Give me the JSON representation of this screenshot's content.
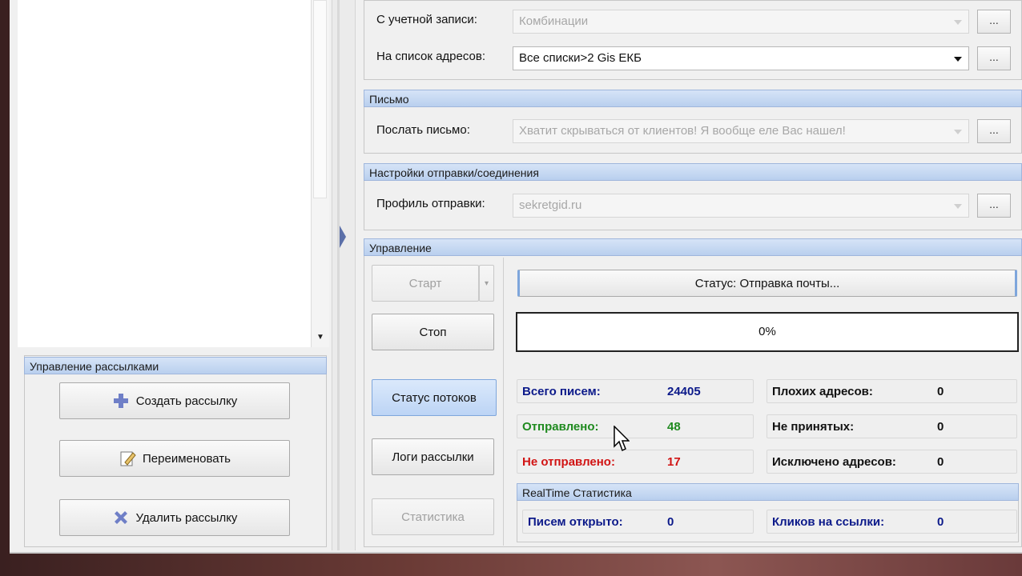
{
  "account": {
    "label": "С учетной записи:",
    "value": "Комбинации",
    "more": "..."
  },
  "address_list": {
    "label": "На список адресов:",
    "value": "Все списки>2 Gis ЕКБ",
    "more": "..."
  },
  "letter_group": {
    "title": "Письмо",
    "label": "Послать письмо:",
    "value": "Хватит скрываться от клиентов! Я вообще еле Вас нашел!",
    "more": "..."
  },
  "connection_group": {
    "title": "Настройки отправки/соединения",
    "label": "Профиль отправки:",
    "value": "sekretgid.ru",
    "more": "..."
  },
  "control_group": {
    "title": "Управление",
    "start_label": "Старт",
    "stop_label": "Стоп",
    "threads_label": "Статус потоков",
    "logs_label": "Логи рассылки",
    "stats_label": "Статистика",
    "status_text": "Статус: Отправка почты...",
    "progress_text": "0%",
    "progress_value": 0
  },
  "stats": {
    "total_label": "Всего писем:",
    "total_value": "24405",
    "sent_label": "Отправлено:",
    "sent_value": "48",
    "unsent_label": "Не отправлено:",
    "unsent_value": "17",
    "bad_label": "Плохих адресов:",
    "bad_value": "0",
    "rejected_label": "Не принятых:",
    "rejected_value": "0",
    "excluded_label": "Исключено адресов:",
    "excluded_value": "0"
  },
  "realtime": {
    "title": "RealTime Статистика",
    "opened_label": "Писем открыто:",
    "opened_value": "0",
    "clicks_label": "Кликов на ссылки:",
    "clicks_value": "0"
  },
  "mailings_group": {
    "title": "Управление рассылками",
    "create_label": "Создать рассылку",
    "rename_label": "Переименовать",
    "delete_label": "Удалить рассылку"
  },
  "colors": {
    "total": "#0c1a8a",
    "sent": "#1f8a1f",
    "unsent": "#d11414",
    "neutral": "#111111"
  }
}
